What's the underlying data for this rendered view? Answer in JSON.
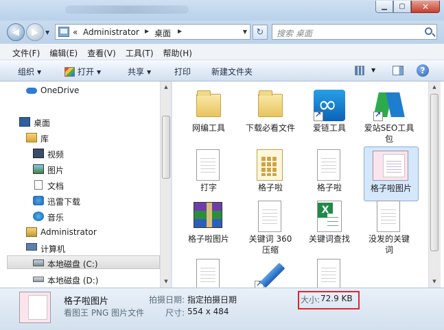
{
  "window": {
    "min_label": "▁",
    "max_label": "▢",
    "close_label": "✕"
  },
  "nav": {
    "back_glyph": "◀",
    "forward_glyph": "▶",
    "history_glyph": "▼"
  },
  "address": {
    "overflow": "«",
    "crumbs": [
      "Administrator",
      "桌面"
    ],
    "dropdown_glyph": "▼",
    "refresh_glyph": "↻"
  },
  "search": {
    "placeholder": "搜索 桌面"
  },
  "menubar": {
    "items": [
      "文件(F)",
      "编辑(E)",
      "查看(V)",
      "工具(T)",
      "帮助(H)"
    ]
  },
  "toolbar": {
    "organize": "组织",
    "open": "打开",
    "share": "共享",
    "print": "打印",
    "new_folder": "新建文件夹",
    "arrow": "▼",
    "help": "?"
  },
  "navpane": {
    "items": [
      {
        "label": "OneDrive",
        "icon": "onedrive-icon"
      },
      {
        "label": "桌面",
        "icon": "desktop-icon"
      },
      {
        "label": "库",
        "icon": "library-icon"
      },
      {
        "label": "视频",
        "icon": "video-icon"
      },
      {
        "label": "图片",
        "icon": "pictures-icon"
      },
      {
        "label": "文档",
        "icon": "documents-icon"
      },
      {
        "label": "迅雷下载",
        "icon": "thunder-icon"
      },
      {
        "label": "音乐",
        "icon": "music-icon"
      },
      {
        "label": "Administrator",
        "icon": "user-folder-icon"
      },
      {
        "label": "计算机",
        "icon": "computer-icon"
      },
      {
        "label": "本地磁盘 (C:)",
        "icon": "drive-c-icon"
      },
      {
        "label": "本地磁盘 (D:)",
        "icon": "drive-d-icon"
      }
    ],
    "selected": "本地磁盘 (C:)"
  },
  "files": [
    {
      "name": "网编工具",
      "icon": "folder-icon"
    },
    {
      "name": "下载必看文件",
      "icon": "folder-icon"
    },
    {
      "name": "爱链工具",
      "icon": "ailian-app-icon"
    },
    {
      "name": "爱站SEO工具包",
      "icon": "aizhan-seo-icon"
    },
    {
      "name": "打字",
      "icon": "text-file-icon"
    },
    {
      "name": "格子啦",
      "icon": "gallery-icon"
    },
    {
      "name": "格子啦",
      "icon": "text-file-icon"
    },
    {
      "name": "格子啦图片",
      "icon": "png-image-icon"
    },
    {
      "name": "格子啦图片",
      "icon": "winrar-archive-icon"
    },
    {
      "name": "关键词 360压缩",
      "icon": "text-file-icon"
    },
    {
      "name": "关键词查找",
      "icon": "excel-file-icon"
    },
    {
      "name": "没发的关键词",
      "icon": "text-file-icon"
    },
    {
      "name": "",
      "icon": "text-file-icon"
    },
    {
      "name": "",
      "icon": "pencil-app-icon"
    },
    {
      "name": "",
      "icon": "text-file-icon"
    }
  ],
  "selected_file": "格子啦图片",
  "details": {
    "name": "格子啦图片",
    "type": "看图王 PNG 图片文件",
    "date_label": "拍摄日期:",
    "date_value": "指定拍摄日期",
    "size_label": "大小:",
    "size_value": "72.9 KB",
    "dim_label": "尺寸:",
    "dim_value": "554 x 484"
  },
  "colors": {
    "highlight_box": "#e0242f",
    "selection": "#d5e7fb",
    "chrome": "#bcd2e9"
  }
}
